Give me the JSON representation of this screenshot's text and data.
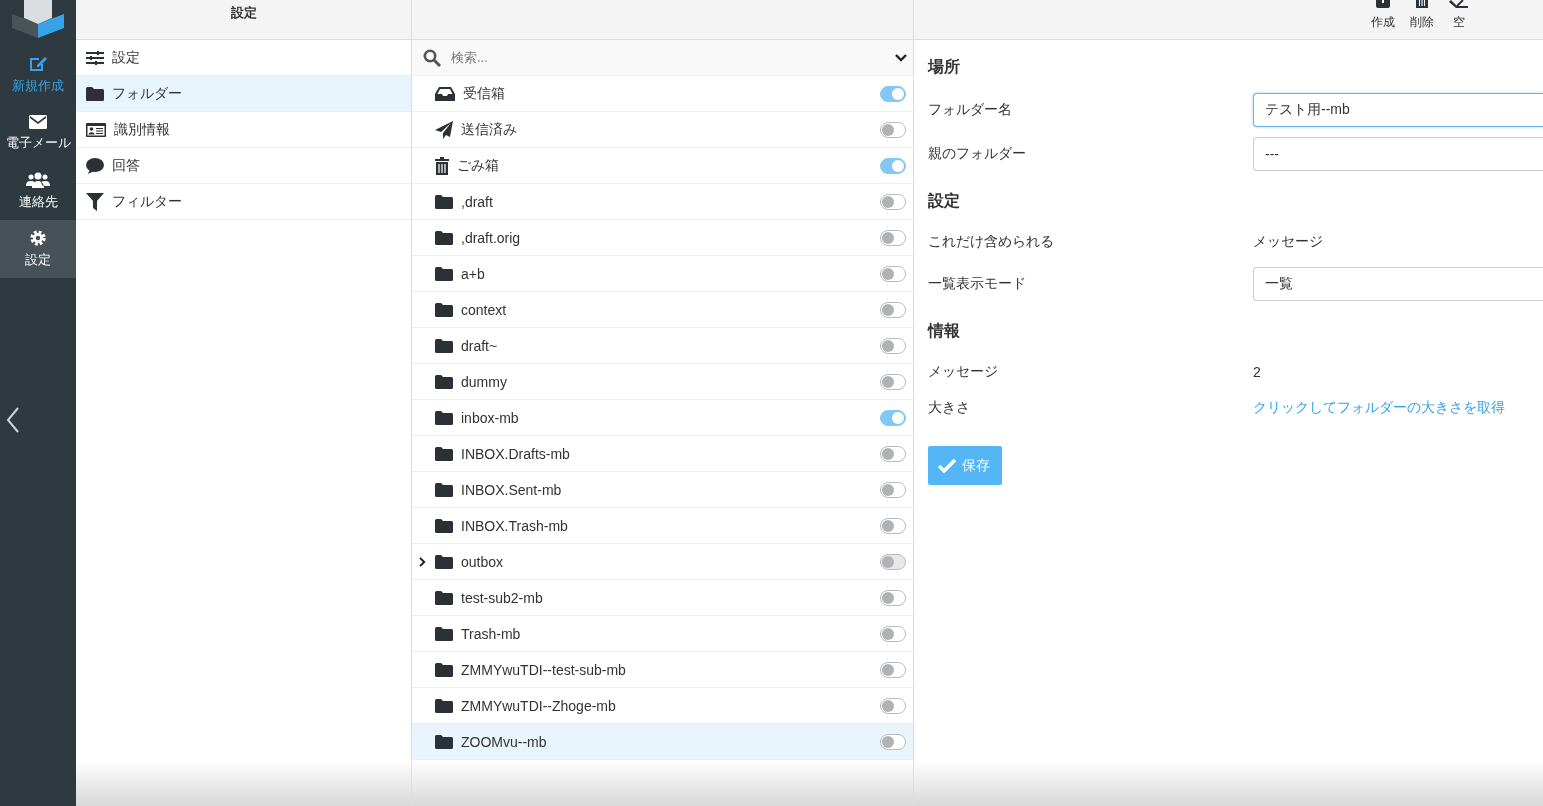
{
  "nav": [
    {
      "label": "新規作成",
      "kind": "compose",
      "selected": false
    },
    {
      "label": "電子メール",
      "kind": "mail",
      "selected": false
    },
    {
      "label": "連絡先",
      "kind": "contacts",
      "selected": false
    },
    {
      "label": "設定",
      "kind": "settings",
      "selected": true
    }
  ],
  "settings_panel": {
    "title": "設定",
    "items": [
      {
        "label": "設定",
        "kind": "preferences",
        "selected": false
      },
      {
        "label": "フォルダー",
        "kind": "folders",
        "selected": true
      },
      {
        "label": "識別情報",
        "kind": "identities",
        "selected": false
      },
      {
        "label": "回答",
        "kind": "responses",
        "selected": false
      },
      {
        "label": "フィルター",
        "kind": "filters",
        "selected": false
      }
    ]
  },
  "folders": {
    "search_placeholder": "検索...",
    "items": [
      {
        "name": "受信箱",
        "kind": "inbox",
        "subscribed": true,
        "disabled": false,
        "has_children": false,
        "selected": false
      },
      {
        "name": "送信済み",
        "kind": "sent",
        "subscribed": false,
        "disabled": false,
        "has_children": false,
        "selected": false
      },
      {
        "name": "ごみ箱",
        "kind": "trash",
        "subscribed": true,
        "disabled": false,
        "has_children": false,
        "selected": false
      },
      {
        "name": ",draft",
        "kind": "folder",
        "subscribed": false,
        "disabled": false,
        "has_children": false,
        "selected": false
      },
      {
        "name": ",draft.orig",
        "kind": "folder",
        "subscribed": false,
        "disabled": false,
        "has_children": false,
        "selected": false
      },
      {
        "name": "a+b",
        "kind": "folder",
        "subscribed": false,
        "disabled": false,
        "has_children": false,
        "selected": false
      },
      {
        "name": "context",
        "kind": "folder",
        "subscribed": false,
        "disabled": false,
        "has_children": false,
        "selected": false
      },
      {
        "name": "draft~",
        "kind": "folder",
        "subscribed": false,
        "disabled": false,
        "has_children": false,
        "selected": false
      },
      {
        "name": "dummy",
        "kind": "folder",
        "subscribed": false,
        "disabled": false,
        "has_children": false,
        "selected": false
      },
      {
        "name": "inbox-mb",
        "kind": "folder",
        "subscribed": true,
        "disabled": false,
        "has_children": false,
        "selected": false
      },
      {
        "name": "INBOX.Drafts-mb",
        "kind": "folder",
        "subscribed": false,
        "disabled": false,
        "has_children": false,
        "selected": false
      },
      {
        "name": "INBOX.Sent-mb",
        "kind": "folder",
        "subscribed": false,
        "disabled": false,
        "has_children": false,
        "selected": false
      },
      {
        "name": "INBOX.Trash-mb",
        "kind": "folder",
        "subscribed": false,
        "disabled": false,
        "has_children": false,
        "selected": false
      },
      {
        "name": "outbox",
        "kind": "folder",
        "subscribed": false,
        "disabled": true,
        "has_children": true,
        "selected": false
      },
      {
        "name": "test-sub2-mb",
        "kind": "folder",
        "subscribed": false,
        "disabled": false,
        "has_children": false,
        "selected": false
      },
      {
        "name": "Trash-mb",
        "kind": "folder",
        "subscribed": false,
        "disabled": false,
        "has_children": false,
        "selected": false
      },
      {
        "name": "ZMMYwuTDI--test-sub-mb",
        "kind": "folder",
        "subscribed": false,
        "disabled": false,
        "has_children": false,
        "selected": false
      },
      {
        "name": "ZMMYwuTDI--Zhoge-mb",
        "kind": "folder",
        "subscribed": false,
        "disabled": false,
        "has_children": false,
        "selected": false
      },
      {
        "name": "ZOOMvu--mb",
        "kind": "folder",
        "subscribed": false,
        "disabled": false,
        "has_children": false,
        "selected": true
      }
    ]
  },
  "toolbar": [
    {
      "label": "作成",
      "kind": "create"
    },
    {
      "label": "削除",
      "kind": "delete"
    },
    {
      "label": "空",
      "kind": "empty"
    }
  ],
  "form": {
    "sections": [
      {
        "title": "場所",
        "rows": [
          {
            "label": "フォルダー名",
            "kind": "input",
            "value": "テスト用--mb",
            "focused": true
          },
          {
            "label": "親のフォルダー",
            "kind": "select",
            "value": "---",
            "focused": false
          }
        ]
      },
      {
        "title": "設定",
        "rows": [
          {
            "label": "これだけ含められる",
            "kind": "text",
            "value": "メッセージ"
          },
          {
            "label": "一覧表示モード",
            "kind": "select",
            "value": "一覧",
            "focused": false
          }
        ]
      },
      {
        "title": "情報",
        "rows": [
          {
            "label": "メッセージ",
            "kind": "text",
            "value": "2"
          },
          {
            "label": "大きさ",
            "kind": "link",
            "value": "クリックしてフォルダーの大きさを取得"
          }
        ]
      }
    ],
    "save_button": "保存"
  }
}
